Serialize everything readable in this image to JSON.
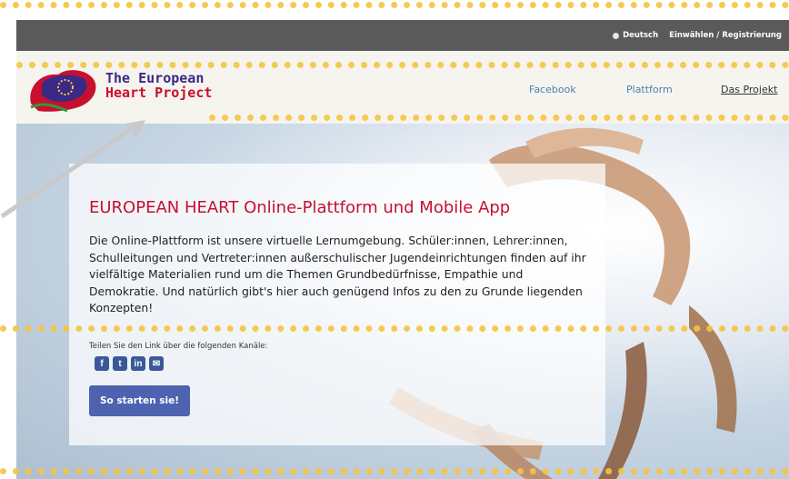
{
  "topbar": {
    "language": "Deutsch",
    "login": "Einwählen / Registrierung"
  },
  "logo": {
    "line1": "The European",
    "line2": "Heart Project"
  },
  "nav": {
    "items": [
      "Facebook",
      "Plattform",
      "Das Projekt"
    ]
  },
  "hero": {
    "headline": "EUROPEAN HEART Online-Plattform und Mobile App",
    "body": "Die Online-Plattform ist unsere virtuelle Lernumgebung. Schüler:innen, Lehrer:innen, Schulleitungen und Vertreter:innen außerschulischer Jugendeinrichtungen finden auf ihr vielfältige Materialien rund um die Themen Grundbedürfnisse, Empathie und Demokratie. Und natürlich gibt's hier auch genügend Infos zu den zu Grunde liegenden Konzepten!",
    "share_label": "Teilen Sie den Link über die folgenden Kanäle:",
    "share_icons": [
      "facebook-icon",
      "twitter-icon",
      "linkedin-icon",
      "email-icon"
    ],
    "start_button": "So starten sie!"
  },
  "colors": {
    "accent_red": "#c8102e",
    "button_blue": "#4d63b0",
    "topbar_gray": "#5a5a5a",
    "dash_yellow": "#f5c542"
  }
}
